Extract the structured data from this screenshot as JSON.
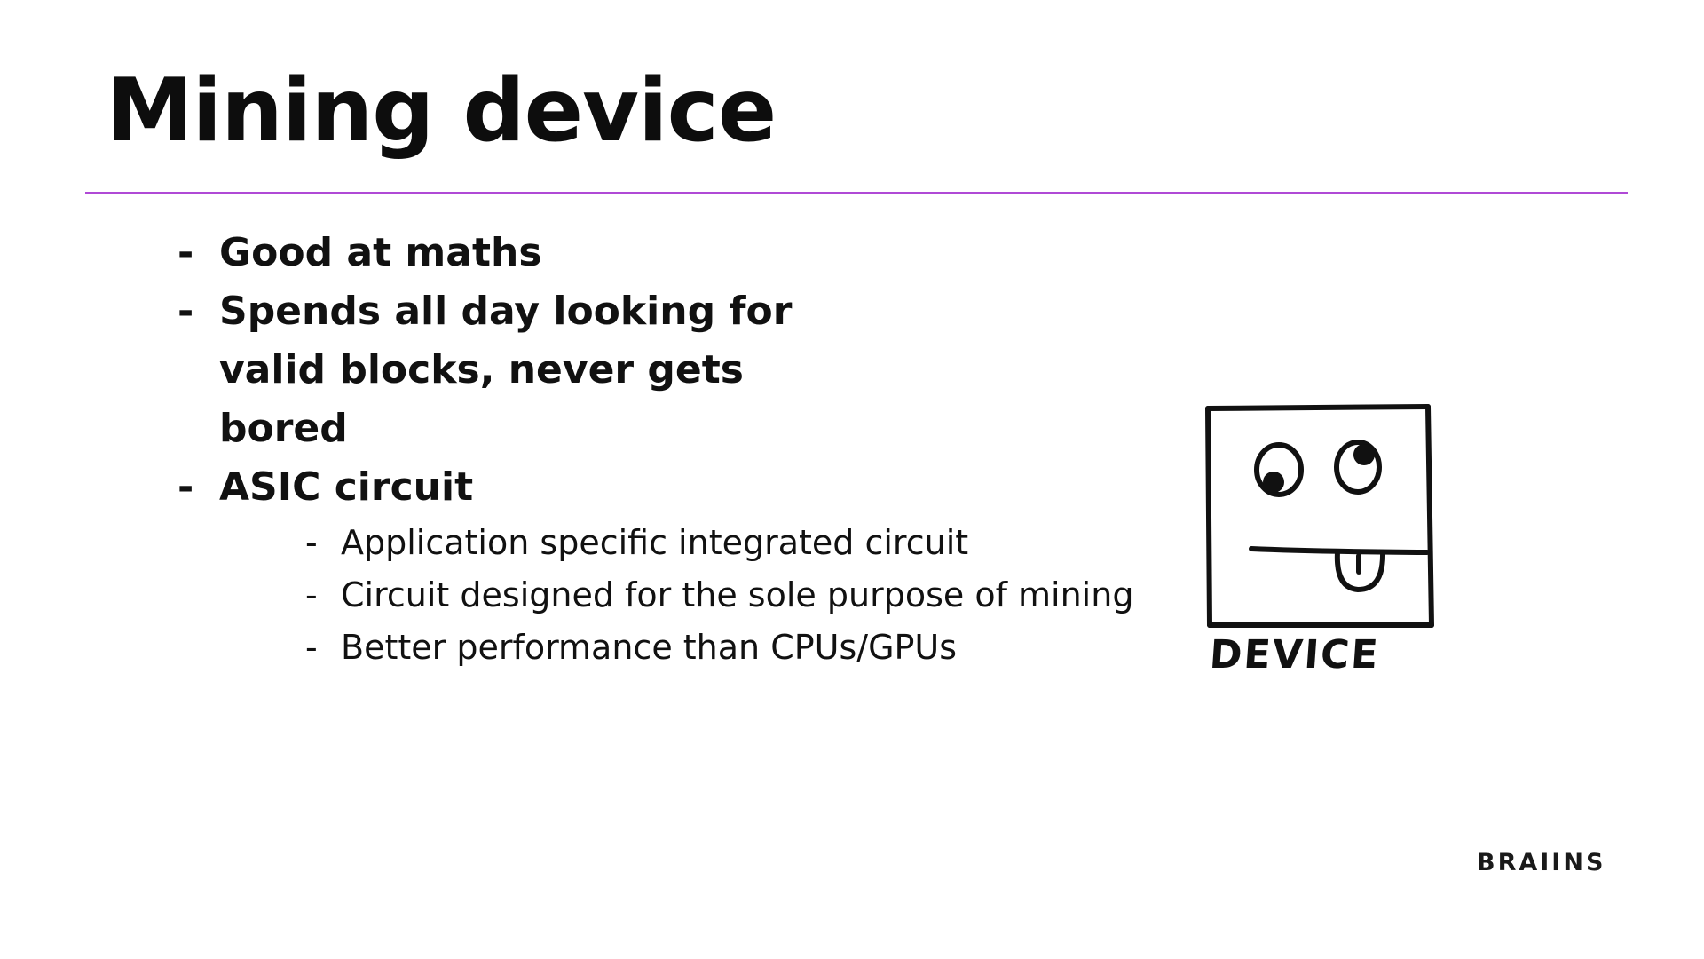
{
  "slide": {
    "title": "Mining device",
    "accent_color": "#b04ad6",
    "bullets": [
      {
        "marker": "-",
        "text": "Good at maths"
      },
      {
        "marker": "-",
        "text": "Spends all day looking for valid blocks, never gets bored"
      },
      {
        "marker": "-",
        "text": "ASIC circuit"
      }
    ],
    "sub_bullets": [
      {
        "marker": "-",
        "text": "Application specific integrated circuit"
      },
      {
        "marker": "-",
        "text": "Circuit designed for the sole purpose of mining"
      },
      {
        "marker": "-",
        "text": "Better performance than CPUs/GPUs"
      }
    ],
    "illustration": {
      "icon": "smiley-device-icon",
      "caption": "DEVICE"
    },
    "logo": "BRAIINS"
  }
}
